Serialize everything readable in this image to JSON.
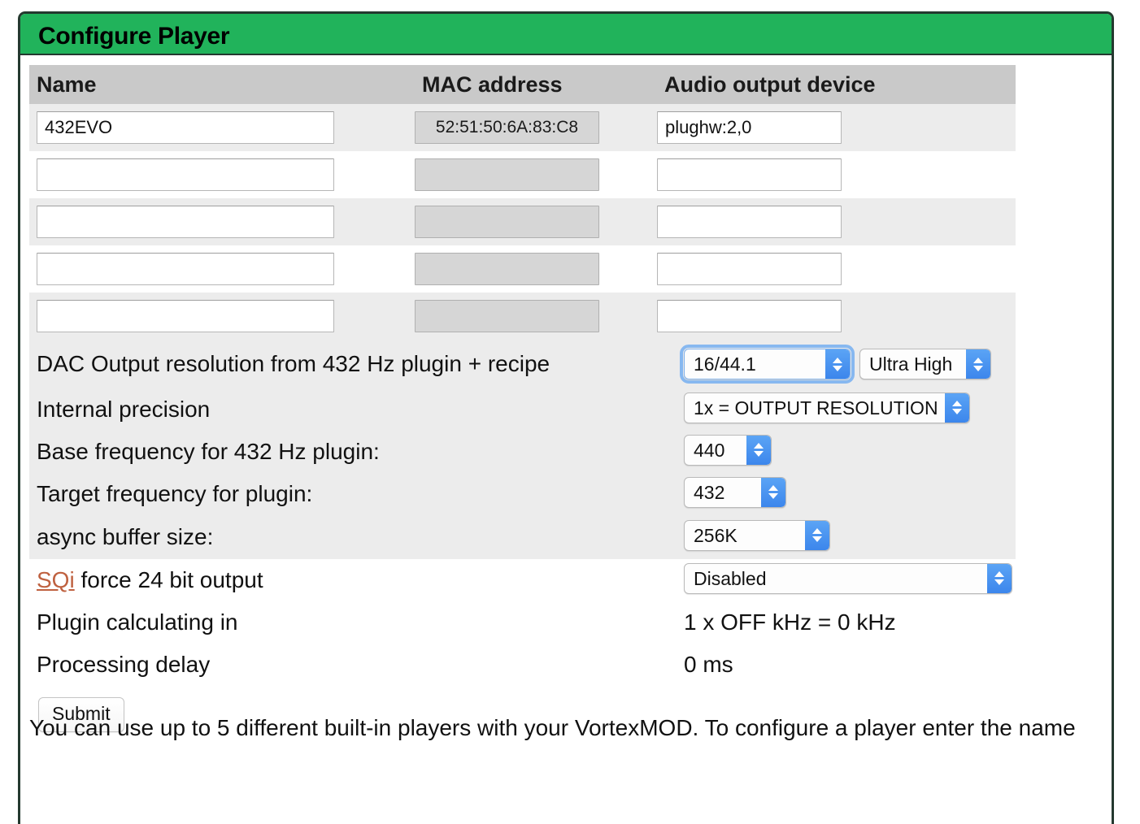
{
  "header": {
    "title": "Configure Player"
  },
  "table": {
    "columns": [
      "Name",
      "MAC address",
      "Audio output device"
    ],
    "rows": [
      {
        "name": "432EVO",
        "mac": "52:51:50:6A:83:C8",
        "audio": "plughw:2,0"
      },
      {
        "name": "",
        "mac": "",
        "audio": ""
      },
      {
        "name": "",
        "mac": "",
        "audio": ""
      },
      {
        "name": "",
        "mac": "",
        "audio": ""
      },
      {
        "name": "",
        "mac": "",
        "audio": ""
      }
    ],
    "name_placeholder": "",
    "mac_placeholder": "",
    "audio_placeholder": ""
  },
  "settings": {
    "dac_resolution": {
      "label": "DAC Output resolution from 432 Hz plugin + recipe",
      "resolution_value": "16/44.1",
      "quality_value": "Ultra High"
    },
    "internal_precision": {
      "label": "Internal precision",
      "value": "1x = OUTPUT RESOLUTION"
    },
    "base_frequency": {
      "label": "Base frequency for 432 Hz plugin:",
      "value": "440"
    },
    "target_frequency": {
      "label": "Target frequency for plugin:",
      "value": "432"
    },
    "async_buffer": {
      "label": "async buffer size:",
      "value": "256K"
    }
  },
  "extras": {
    "sqi_link": "SQi",
    "sqi_label_rest": " force 24 bit output",
    "sqi_value": "Disabled",
    "plugin_calculating_label": "Plugin calculating in",
    "plugin_calculating_value": "1 x OFF kHz = 0 kHz",
    "processing_delay_label": "Processing delay",
    "processing_delay_value": "0 ms"
  },
  "actions": {
    "submit_label": "Submit"
  },
  "footer": {
    "note": "You can use up to 5 different built-in players with your VortexMOD. To configure a player enter the name"
  },
  "colors": {
    "header_green": "#21b35b",
    "frame_border": "#24392f",
    "link_orange": "#bf6140",
    "select_blue": "#3c86ec",
    "stripe_gray": "#ececec",
    "thead_gray": "#c9c9c9",
    "disabled_gray": "#d6d6d6"
  }
}
